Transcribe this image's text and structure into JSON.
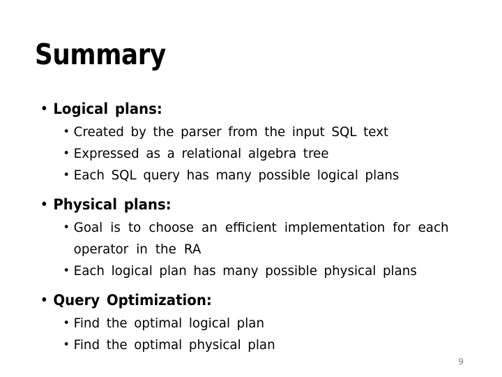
{
  "slide": {
    "title": "Summary",
    "page_number": "9",
    "background_color": "#ffffff",
    "text_color": "#000000",
    "page_number_color": "#808080",
    "bullet_glyph": "•"
  },
  "sections": [
    {
      "heading": "Logical  plans:",
      "items": [
        "Created  by  the  parser  from  the  input  SQL  text",
        "Expressed  as  a  relational  algebra  tree",
        "Each  SQL  query  has  many  possible  logical  plans"
      ]
    },
    {
      "heading": "Physical  plans:",
      "items": [
        "Goal  is  to  choose  an  efficient  implementation  for  each  operator  in  the  RA",
        "Each  logical  plan  has  many  possible  physical  plans"
      ]
    },
    {
      "heading": "Query  Optimization:",
      "items": [
        "Find  the  optimal  logical  plan",
        "Find  the  optimal  physical  plan"
      ]
    }
  ]
}
